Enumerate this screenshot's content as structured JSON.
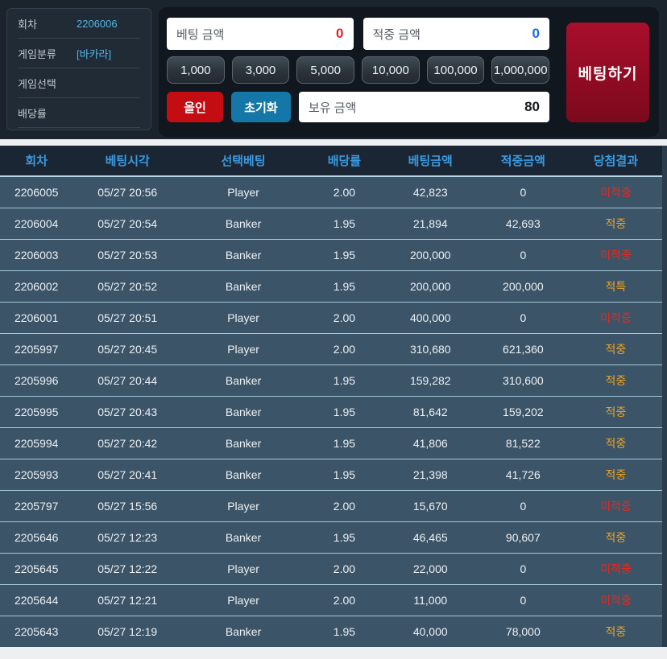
{
  "sidebar": {
    "items": [
      {
        "label": "회차",
        "value": "2206006"
      },
      {
        "label": "게임분류",
        "value": "[바카라]"
      },
      {
        "label": "게임선택",
        "value": ""
      },
      {
        "label": "배당률",
        "value": ""
      }
    ]
  },
  "bet_panel": {
    "bet_amount": {
      "label": "베팅 금액",
      "value": "0"
    },
    "win_amount": {
      "label": "적중 금액",
      "value": "0"
    },
    "chips": [
      "1,000",
      "3,000",
      "5,000",
      "10,000",
      "100,000",
      "1,000,000"
    ],
    "all_in_label": "올인",
    "reset_label": "초기화",
    "balance": {
      "label": "보유 금액",
      "value": "80"
    },
    "bet_button_label": "베팅하기"
  },
  "colors": {
    "accent_blue": "#3b9ae0",
    "bet_red": "#d7282e",
    "win_blue": "#1b6ce0",
    "hit_orange": "#f0a41e",
    "miss_red": "#e8281e"
  },
  "history": {
    "columns": [
      "회차",
      "베팅시각",
      "선택베팅",
      "배당률",
      "베팅금액",
      "적중금액",
      "당첨결과"
    ],
    "rows": [
      {
        "round": "2206005",
        "time": "05/27 20:56",
        "pick": "Player",
        "odds": "2.00",
        "bet": "42,823",
        "win": "0",
        "result": "미적중",
        "result_type": "miss"
      },
      {
        "round": "2206004",
        "time": "05/27 20:54",
        "pick": "Banker",
        "odds": "1.95",
        "bet": "21,894",
        "win": "42,693",
        "result": "적중",
        "result_type": "hit"
      },
      {
        "round": "2206003",
        "time": "05/27 20:53",
        "pick": "Banker",
        "odds": "1.95",
        "bet": "200,000",
        "win": "0",
        "result": "미적중",
        "result_type": "miss"
      },
      {
        "round": "2206002",
        "time": "05/27 20:52",
        "pick": "Banker",
        "odds": "1.95",
        "bet": "200,000",
        "win": "200,000",
        "result": "적특",
        "result_type": "special"
      },
      {
        "round": "2206001",
        "time": "05/27 20:51",
        "pick": "Player",
        "odds": "2.00",
        "bet": "400,000",
        "win": "0",
        "result": "미적중",
        "result_type": "miss"
      },
      {
        "round": "2205997",
        "time": "05/27 20:45",
        "pick": "Player",
        "odds": "2.00",
        "bet": "310,680",
        "win": "621,360",
        "result": "적중",
        "result_type": "hit"
      },
      {
        "round": "2205996",
        "time": "05/27 20:44",
        "pick": "Banker",
        "odds": "1.95",
        "bet": "159,282",
        "win": "310,600",
        "result": "적중",
        "result_type": "hit"
      },
      {
        "round": "2205995",
        "time": "05/27 20:43",
        "pick": "Banker",
        "odds": "1.95",
        "bet": "81,642",
        "win": "159,202",
        "result": "적중",
        "result_type": "hit"
      },
      {
        "round": "2205994",
        "time": "05/27 20:42",
        "pick": "Banker",
        "odds": "1.95",
        "bet": "41,806",
        "win": "81,522",
        "result": "적중",
        "result_type": "hit"
      },
      {
        "round": "2205993",
        "time": "05/27 20:41",
        "pick": "Banker",
        "odds": "1.95",
        "bet": "21,398",
        "win": "41,726",
        "result": "적중",
        "result_type": "hit"
      },
      {
        "round": "2205797",
        "time": "05/27 15:56",
        "pick": "Player",
        "odds": "2.00",
        "bet": "15,670",
        "win": "0",
        "result": "미적중",
        "result_type": "miss"
      },
      {
        "round": "2205646",
        "time": "05/27 12:23",
        "pick": "Banker",
        "odds": "1.95",
        "bet": "46,465",
        "win": "90,607",
        "result": "적중",
        "result_type": "hit"
      },
      {
        "round": "2205645",
        "time": "05/27 12:22",
        "pick": "Player",
        "odds": "2.00",
        "bet": "22,000",
        "win": "0",
        "result": "미적중",
        "result_type": "miss"
      },
      {
        "round": "2205644",
        "time": "05/27 12:21",
        "pick": "Player",
        "odds": "2.00",
        "bet": "11,000",
        "win": "0",
        "result": "미적중",
        "result_type": "miss"
      },
      {
        "round": "2205643",
        "time": "05/27 12:19",
        "pick": "Banker",
        "odds": "1.95",
        "bet": "40,000",
        "win": "78,000",
        "result": "적중",
        "result_type": "hit"
      }
    ]
  }
}
